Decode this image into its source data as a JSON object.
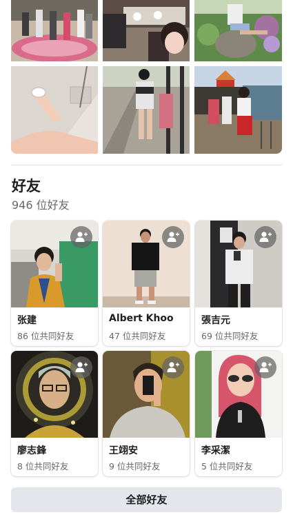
{
  "friends_section": {
    "title": "好友",
    "count_text": "946 位好友",
    "all_friends_label": "全部好友"
  },
  "friends": [
    {
      "name": "张建",
      "mutual": "86 位共同好友"
    },
    {
      "name": "Albert Khoo",
      "mutual": "47 位共同好友"
    },
    {
      "name": "張吉元",
      "mutual": "69 位共同好友"
    },
    {
      "name": "廖志鋒",
      "mutual": "8 位共同好友"
    },
    {
      "name": "王翊安",
      "mutual": "9 位共同好友"
    },
    {
      "name": "李采潔",
      "mutual": "5 位共同好友"
    }
  ],
  "icons": {
    "add_friend": "add-friend-icon"
  },
  "colors": {
    "text_primary": "#1c1e21",
    "text_secondary": "#65676b",
    "button_bg": "#e4e6eb",
    "divider": "#dcdfe3"
  }
}
